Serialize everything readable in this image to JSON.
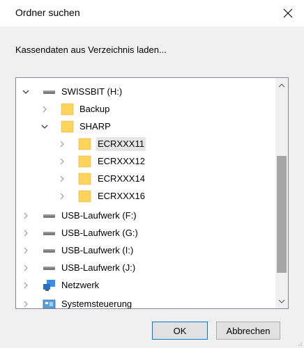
{
  "dialog": {
    "title": "Ordner suchen",
    "close_glyph": "✕",
    "instruction": "Kassendaten aus Verzeichnis laden..."
  },
  "tree": {
    "items": [
      {
        "label": "SWISSBIT (H:)",
        "icon": "drive-icon",
        "expanded": true
      },
      {
        "label": "Backup",
        "icon": "folder-icon",
        "expanded": false
      },
      {
        "label": "SHARP",
        "icon": "folder-icon",
        "expanded": true
      },
      {
        "label": "ECRXXX11",
        "icon": "folder-icon",
        "expanded": false,
        "selected": true
      },
      {
        "label": "ECRXXX12",
        "icon": "folder-icon",
        "expanded": false
      },
      {
        "label": "ECRXXX14",
        "icon": "folder-icon",
        "expanded": false
      },
      {
        "label": "ECRXXX16",
        "icon": "folder-icon",
        "expanded": false
      },
      {
        "label": "USB-Laufwerk (F:)",
        "icon": "drive-icon",
        "expanded": false
      },
      {
        "label": "USB-Laufwerk (G:)",
        "icon": "drive-icon",
        "expanded": false
      },
      {
        "label": "USB-Laufwerk (I:)",
        "icon": "drive-icon",
        "expanded": false
      },
      {
        "label": "USB-Laufwerk (J:)",
        "icon": "drive-icon",
        "expanded": false
      },
      {
        "label": "Netzwerk",
        "icon": "network-icon",
        "expanded": false
      },
      {
        "label": "Systemsteuerung",
        "icon": "control-panel-icon",
        "expanded": false
      }
    ]
  },
  "buttons": {
    "ok": "OK",
    "cancel": "Abbrechen"
  },
  "colors": {
    "folder": "#ffd35c",
    "selection": "#e5e5e5",
    "scroll_thumb": "#a6a6a6",
    "accent": "#0078d7"
  }
}
